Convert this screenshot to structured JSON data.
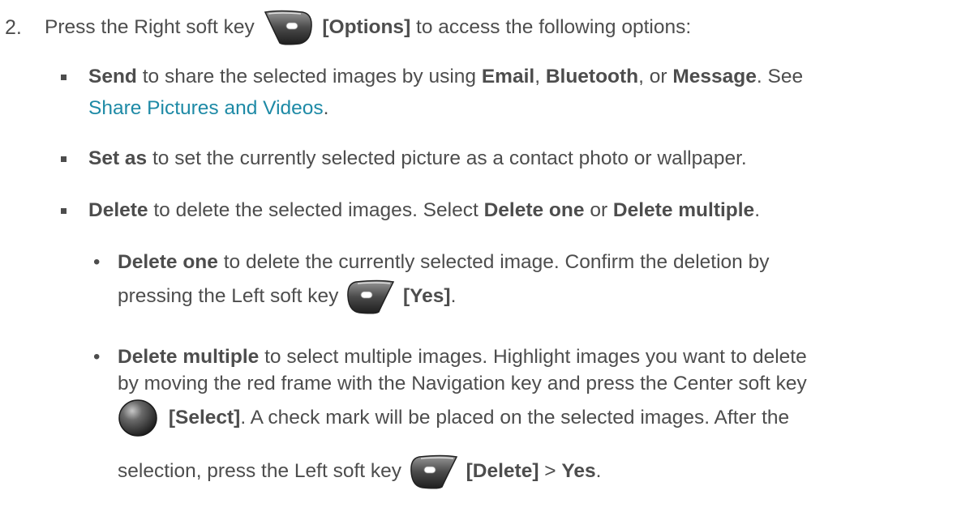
{
  "step_number": "2.",
  "step": {
    "pre": "Press the Right soft key",
    "key_label": "[Options]",
    "post": "to access the following options:"
  },
  "bullets": {
    "send": {
      "term": "Send",
      "t1": "to share the selected images by using",
      "email": "Email",
      "c1": ",",
      "bluetooth": "Bluetooth",
      "c2": ", or",
      "message": "Message",
      "t2": ". See",
      "link": "Share Pictures and Videos",
      "t3": "."
    },
    "setas": {
      "term": "Set as",
      "text": "to set the currently selected picture as a contact photo or wallpaper."
    },
    "delete": {
      "term": "Delete",
      "t1": "to delete the selected images. Select",
      "opt1": "Delete one",
      "or": "or",
      "opt2": "Delete multiple",
      "t2": "."
    }
  },
  "sub": {
    "one": {
      "term": "Delete one",
      "l1": "to delete the currently selected image. Confirm the deletion by",
      "l2": "pressing the Left soft key",
      "key_label": "[Yes]",
      "end": "."
    },
    "multiple": {
      "term": "Delete multiple",
      "l1": "to select multiple images. Highlight images you want to delete",
      "l2": "by moving the red frame with the Navigation key and press the Center soft key",
      "key_label": "[Select]",
      "l3": ". A check mark will be placed on the selected images. After the",
      "l4": "selection, press the Left soft key",
      "key_label2": "[Delete]",
      "gt": ">",
      "yes": "Yes",
      "end": "."
    }
  },
  "icons": [
    "right-soft-key-icon",
    "left-soft-key-icon",
    "center-key-icon",
    "square-bullet-icon",
    "round-bullet-icon"
  ],
  "colors": {
    "text": "#4d4d4d",
    "link": "#1e8aa6"
  }
}
